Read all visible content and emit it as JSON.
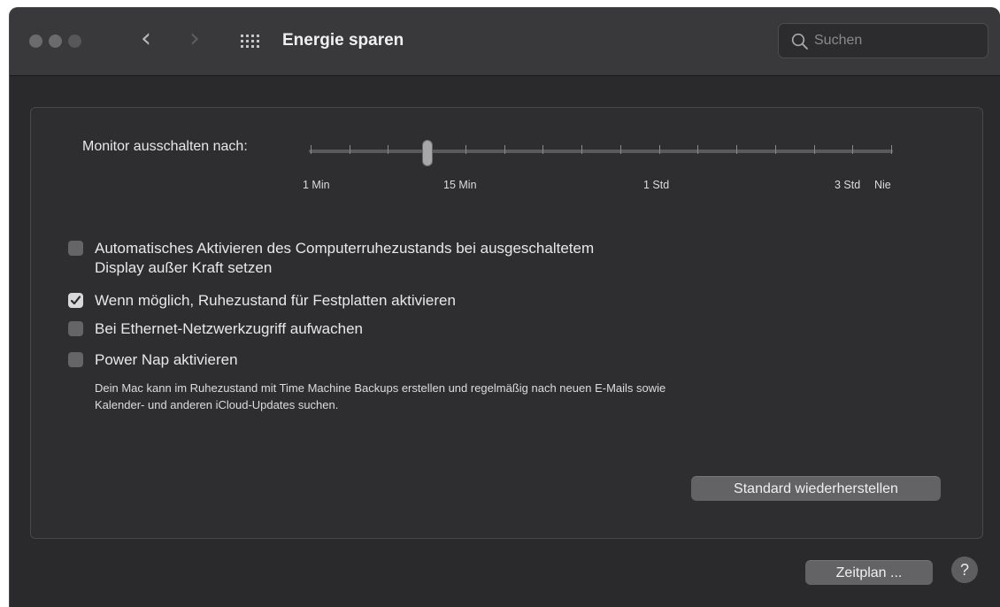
{
  "window": {
    "title": "Energie sparen",
    "traffic_lights": [
      "close",
      "minimize",
      "zoom"
    ],
    "nav": {
      "back_icon": "chevron-left-icon",
      "forward_icon": "chevron-right-icon",
      "grid_icon": "grid-icon"
    }
  },
  "search": {
    "placeholder": "Suchen",
    "value": ""
  },
  "slider": {
    "label": "Monitor ausschalten nach:",
    "tick_labels": [
      "1 Min",
      "15 Min",
      "1 Std",
      "3 Std",
      "Nie"
    ],
    "tick_count": 16,
    "selected_index": 3
  },
  "options": [
    {
      "line1": "Automatisches Aktivieren des Computerruhezustands bei ausgeschaltetem",
      "line2": "Display außer Kraft setzen",
      "checked": false
    },
    {
      "line1": "Wenn möglich, Ruhezustand für Festplatten aktivieren",
      "checked": true
    },
    {
      "line1": "Bei Ethernet-Netzwerkzugriff aufwachen",
      "checked": false
    },
    {
      "line1": "Power Nap aktivieren",
      "checked": false
    }
  ],
  "power_nap_description": {
    "line1": "Dein Mac kann im Ruhezustand mit Time Machine Backups erstellen und regelmäßig nach neuen E-Mails sowie",
    "line2": "Kalender- und anderen iCloud-Updates suchen."
  },
  "buttons": {
    "restore_defaults": "Standard wiederherstellen",
    "schedule": "Zeitplan ...",
    "help": "?"
  },
  "colors": {
    "window_bg": "#2a2a2c",
    "titlebar_bg": "#39393b",
    "button_bg": "#636365"
  }
}
